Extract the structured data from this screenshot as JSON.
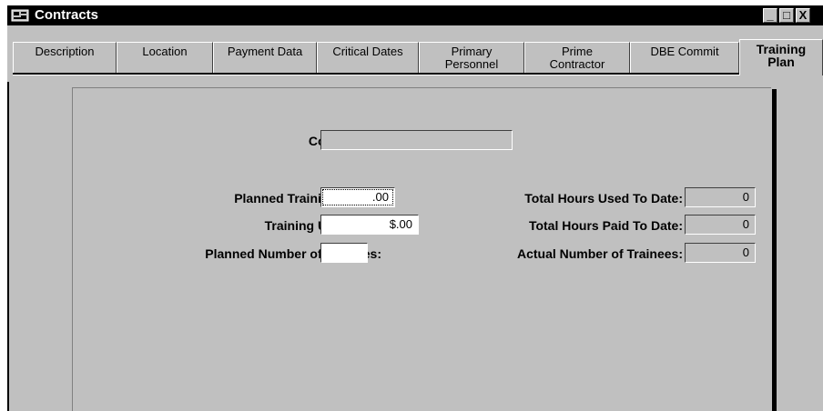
{
  "window": {
    "title": "Contracts",
    "controls": {
      "minimize": "_",
      "maximize": "□",
      "close": "X"
    }
  },
  "tabs": [
    {
      "line1": "Description",
      "line2": ""
    },
    {
      "line1": "Location",
      "line2": ""
    },
    {
      "line1": "Payment Data",
      "line2": ""
    },
    {
      "line1": "Critical Dates",
      "line2": ""
    },
    {
      "line1": "Primary",
      "line2": "Personnel"
    },
    {
      "line1": "Prime",
      "line2": "Contractor"
    },
    {
      "line1": "DBE Commit",
      "line2": ""
    },
    {
      "line1": "Training",
      "line2": "Plan",
      "active": true
    }
  ],
  "form": {
    "contract_id": {
      "label": "Contract ID:",
      "value": ""
    },
    "planned_training_hours": {
      "label": "Planned Training Hours:",
      "value": ".00"
    },
    "training_unit_price": {
      "label": "Training Unit Price:",
      "value": "$.00"
    },
    "planned_number_of_trainees": {
      "label": "Planned Number of Trainees:",
      "value": ""
    },
    "total_hours_used": {
      "label": "Total Hours Used To Date:",
      "value": "0"
    },
    "total_hours_paid": {
      "label": "Total Hours Paid To Date:",
      "value": "0"
    },
    "actual_number_of_trainees": {
      "label": "Actual Number of Trainees:",
      "value": "0"
    }
  },
  "colors": {
    "face": "#c0c0c0",
    "titlebar": "#000000",
    "field": "#ffffff"
  },
  "icons": [
    "contracts-app-icon",
    "minimize-icon",
    "maximize-icon",
    "close-icon"
  ]
}
